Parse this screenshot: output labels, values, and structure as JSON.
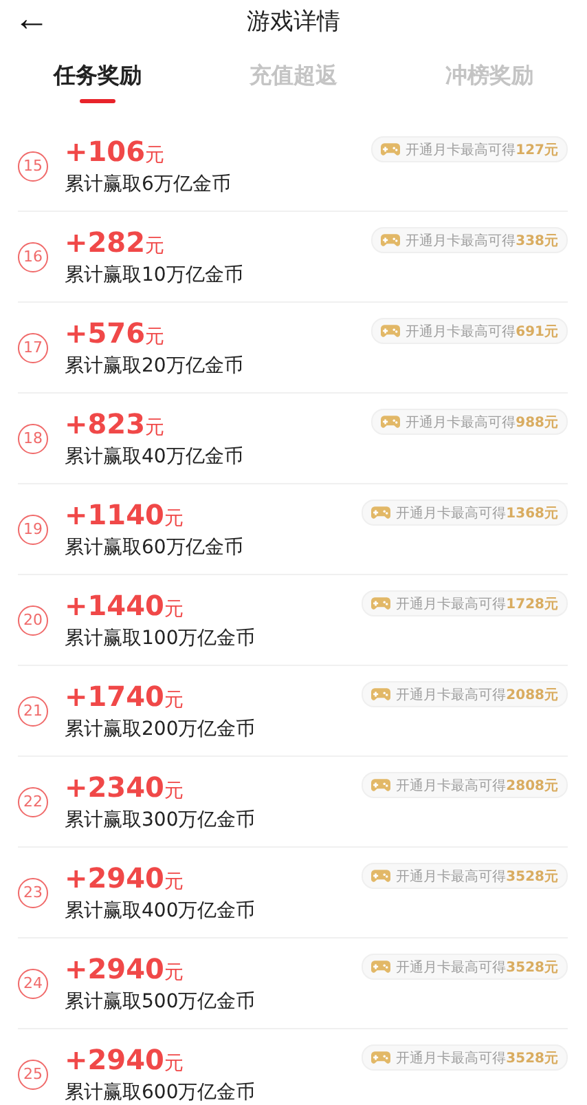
{
  "header": {
    "back": "←",
    "title": "游戏详情"
  },
  "tabs": [
    {
      "label": "任务奖励",
      "selected": true
    },
    {
      "label": "充值超返",
      "selected": false
    },
    {
      "label": "冲榜奖励",
      "selected": false
    }
  ],
  "rewards": [
    {
      "index": "15",
      "value": "+106",
      "unit": "元",
      "description": "累计赢取6万亿金币",
      "badge_label": "开通月卡最高可得",
      "badge_amount": "127元"
    },
    {
      "index": "16",
      "value": "+282",
      "unit": "元",
      "description": "累计赢取10万亿金币",
      "badge_label": "开通月卡最高可得",
      "badge_amount": "338元"
    },
    {
      "index": "17",
      "value": "+576",
      "unit": "元",
      "description": "累计赢取20万亿金币",
      "badge_label": "开通月卡最高可得",
      "badge_amount": "691元"
    },
    {
      "index": "18",
      "value": "+823",
      "unit": "元",
      "description": "累计赢取40万亿金币",
      "badge_label": "开通月卡最高可得",
      "badge_amount": "988元"
    },
    {
      "index": "19",
      "value": "+1140",
      "unit": "元",
      "description": "累计赢取60万亿金币",
      "badge_label": "开通月卡最高可得",
      "badge_amount": "1368元"
    },
    {
      "index": "20",
      "value": "+1440",
      "unit": "元",
      "description": "累计赢取100万亿金币",
      "badge_label": "开通月卡最高可得",
      "badge_amount": "1728元"
    },
    {
      "index": "21",
      "value": "+1740",
      "unit": "元",
      "description": "累计赢取200万亿金币",
      "badge_label": "开通月卡最高可得",
      "badge_amount": "2088元"
    },
    {
      "index": "22",
      "value": "+2340",
      "unit": "元",
      "description": "累计赢取300万亿金币",
      "badge_label": "开通月卡最高可得",
      "badge_amount": "2808元"
    },
    {
      "index": "23",
      "value": "+2940",
      "unit": "元",
      "description": "累计赢取400万亿金币",
      "badge_label": "开通月卡最高可得",
      "badge_amount": "3528元"
    },
    {
      "index": "24",
      "value": "+2940",
      "unit": "元",
      "description": "累计赢取500万亿金币",
      "badge_label": "开通月卡最高可得",
      "badge_amount": "3528元"
    },
    {
      "index": "25",
      "value": "+2940",
      "unit": "元",
      "description": "累计赢取600万亿金币",
      "badge_label": "开通月卡最高可得",
      "badge_amount": "3528元"
    }
  ]
}
